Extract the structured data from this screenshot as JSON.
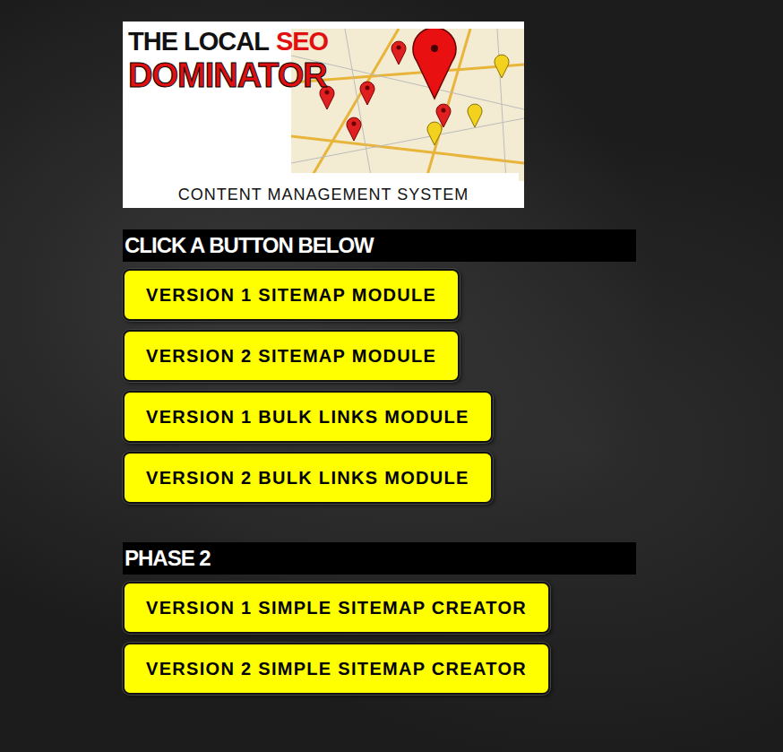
{
  "logo": {
    "line1": "THE LOCAL",
    "line1_accent": "SEO",
    "line2": "DOMINATOR",
    "subtitle": "CONTENT MANAGEMENT SYSTEM"
  },
  "sections": [
    {
      "heading": "CLICK A BUTTON BELOW",
      "buttons": [
        "VERSION 1 SITEMAP MODULE",
        "VERSION 2 SITEMAP MODULE",
        "VERSION 1 BULK LINKS MODULE",
        "VERSION 2 BULK LINKS MODULE"
      ]
    },
    {
      "heading": "PHASE 2",
      "buttons": [
        "VERSION 1 SIMPLE SITEMAP CREATOR",
        "VERSION 2 SIMPLE SITEMAP CREATOR"
      ]
    }
  ]
}
